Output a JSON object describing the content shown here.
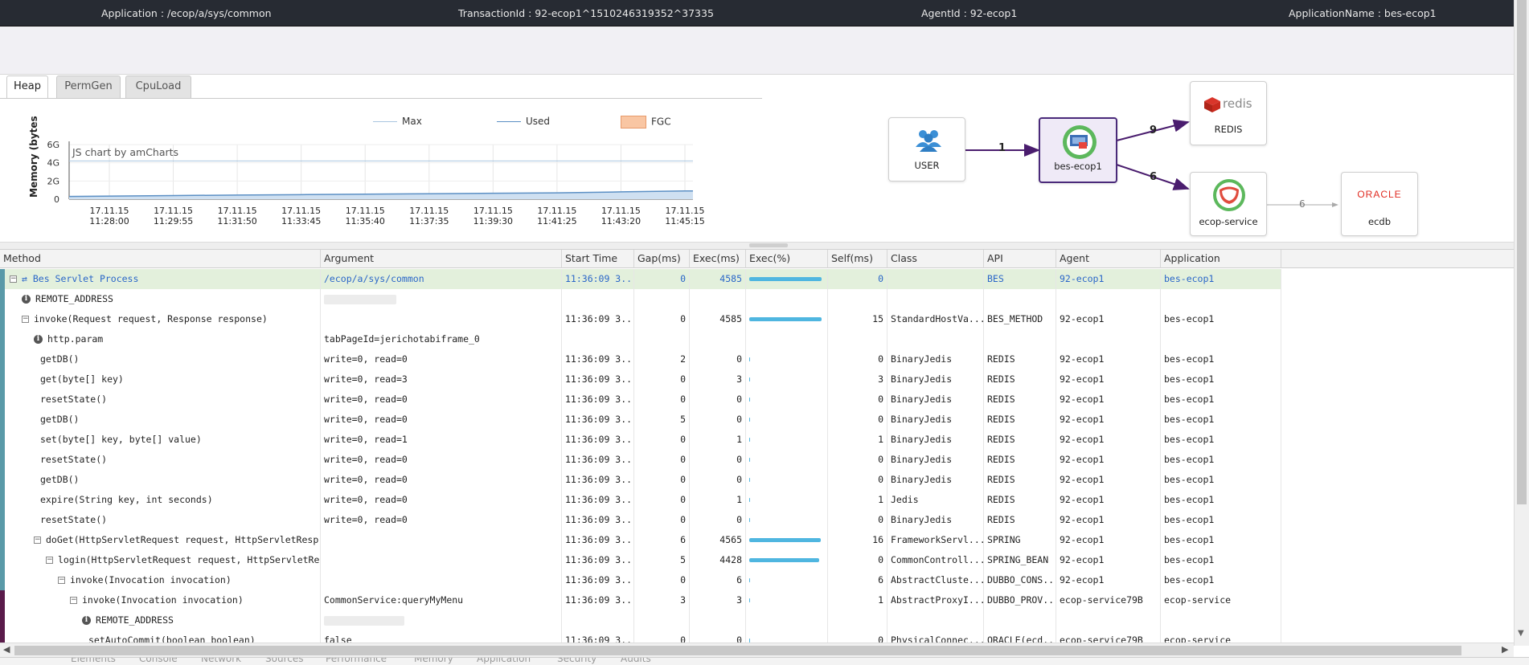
{
  "header": {
    "application": "Application : /ecop/a/sys/common",
    "transaction": "TransactionId : 92-ecop1^1510246319352^37335",
    "agent": "AgentId : 92-ecop1",
    "app_name": "ApplicationName : bes-ecop1"
  },
  "tabs": [
    {
      "label": "Heap",
      "active": true
    },
    {
      "label": "PermGen",
      "active": false
    },
    {
      "label": "CpuLoad",
      "active": false
    }
  ],
  "chart_data": {
    "type": "area",
    "ylabel": "Memory (bytes",
    "yticks": [
      "0",
      "2G",
      "4G",
      "6G"
    ],
    "ylim": [
      0,
      6
    ],
    "watermark": "JS chart by amCharts",
    "legend": [
      "Max",
      "Used",
      "FGC"
    ],
    "xticks": [
      [
        "17.11.15",
        "11:28:00"
      ],
      [
        "17.11.15",
        "11:29:55"
      ],
      [
        "17.11.15",
        "11:31:50"
      ],
      [
        "17.11.15",
        "11:33:45"
      ],
      [
        "17.11.15",
        "11:35:40"
      ],
      [
        "17.11.15",
        "11:37:35"
      ],
      [
        "17.11.15",
        "11:39:30"
      ],
      [
        "17.11.15",
        "11:41:25"
      ],
      [
        "17.11.15",
        "11:43:20"
      ],
      [
        "17.11.15",
        "11:45:15"
      ]
    ],
    "series": [
      {
        "name": "Max",
        "color": "#a9c6e0",
        "values": [
          4.2,
          4.2,
          4.2,
          4.2,
          4.2,
          4.2,
          4.2,
          4.2,
          4.2,
          4.2
        ]
      },
      {
        "name": "Used",
        "color": "#5b8fc4",
        "values": [
          0.3,
          0.4,
          0.45,
          0.5,
          0.55,
          0.6,
          0.65,
          0.7,
          0.8,
          0.9
        ]
      }
    ],
    "colors": {
      "fgc": "#f9c6a3",
      "used_fill": "#cfe0f1"
    }
  },
  "service_map": {
    "nodes": {
      "user": "USER",
      "bes": "bes-ecop1",
      "redis": "REDIS",
      "redis_logo": "redis",
      "ecop": "ecop-service",
      "ecdb": "ecdb",
      "oracle_logo": "ORACLE"
    },
    "edges": {
      "user_bes": "1",
      "bes_redis": "9",
      "bes_ecop": "6",
      "ecop_ecdb": "6"
    }
  },
  "grid": {
    "columns": [
      "Method",
      "Argument",
      "Start Time",
      "Gap(ms)",
      "Exec(ms)",
      "Exec(%)",
      "Self(ms)",
      "Class",
      "API",
      "Agent",
      "Application"
    ],
    "rows": [
      {
        "depth": 0,
        "icon": "toggle",
        "method": "Bes Servlet Process",
        "argument": "/ecop/a/sys/common",
        "start": "11:36:09 3...",
        "gap": "0",
        "exec": "4585",
        "pct": 1.0,
        "self": "0",
        "cls": "",
        "api": "BES",
        "agent": "92-ecop1",
        "app": "bes-ecop1",
        "style": "blue"
      },
      {
        "depth": 1,
        "icon": "info",
        "method": "REMOTE_ADDRESS",
        "argument": "",
        "blur": 90,
        "start": "",
        "gap": "",
        "exec": "",
        "pct": -1,
        "self": "",
        "cls": "",
        "api": "",
        "agent": "",
        "app": ""
      },
      {
        "depth": 1,
        "icon": "toggle",
        "method": "invoke(Request request, Response response)",
        "argument": "",
        "start": "11:36:09 3...",
        "gap": "0",
        "exec": "4585",
        "pct": 1.0,
        "self": "15",
        "cls": "StandardHostVa...",
        "api": "BES_METHOD",
        "agent": "92-ecop1",
        "app": "bes-ecop1"
      },
      {
        "depth": 2,
        "icon": "info",
        "method": "http.param",
        "argument": "tabPageId=jerichotabiframe_0",
        "start": "",
        "gap": "",
        "exec": "",
        "pct": -1,
        "self": "",
        "cls": "",
        "api": "",
        "agent": "",
        "app": ""
      },
      {
        "depth": 2,
        "icon": "",
        "method": "getDB()",
        "argument": "write=0, read=0",
        "start": "11:36:09 3...",
        "gap": "2",
        "exec": "0",
        "pct": 0.0,
        "self": "0",
        "cls": "BinaryJedis",
        "api": "REDIS",
        "agent": "92-ecop1",
        "app": "bes-ecop1"
      },
      {
        "depth": 2,
        "icon": "",
        "method": "get(byte[] key)",
        "argument": "write=0, read=3",
        "start": "11:36:09 3...",
        "gap": "0",
        "exec": "3",
        "pct": 0.0,
        "self": "3",
        "cls": "BinaryJedis",
        "api": "REDIS",
        "agent": "92-ecop1",
        "app": "bes-ecop1"
      },
      {
        "depth": 2,
        "icon": "",
        "method": "resetState()",
        "argument": "write=0, read=0",
        "start": "11:36:09 3...",
        "gap": "0",
        "exec": "0",
        "pct": 0.0,
        "self": "0",
        "cls": "BinaryJedis",
        "api": "REDIS",
        "agent": "92-ecop1",
        "app": "bes-ecop1"
      },
      {
        "depth": 2,
        "icon": "",
        "method": "getDB()",
        "argument": "write=0, read=0",
        "start": "11:36:09 3...",
        "gap": "5",
        "exec": "0",
        "pct": 0.0,
        "self": "0",
        "cls": "BinaryJedis",
        "api": "REDIS",
        "agent": "92-ecop1",
        "app": "bes-ecop1"
      },
      {
        "depth": 2,
        "icon": "",
        "method": "set(byte[] key, byte[] value)",
        "argument": "write=0, read=1",
        "start": "11:36:09 3...",
        "gap": "0",
        "exec": "1",
        "pct": 0.0,
        "self": "1",
        "cls": "BinaryJedis",
        "api": "REDIS",
        "agent": "92-ecop1",
        "app": "bes-ecop1"
      },
      {
        "depth": 2,
        "icon": "",
        "method": "resetState()",
        "argument": "write=0, read=0",
        "start": "11:36:09 3...",
        "gap": "0",
        "exec": "0",
        "pct": 0.0,
        "self": "0",
        "cls": "BinaryJedis",
        "api": "REDIS",
        "agent": "92-ecop1",
        "app": "bes-ecop1"
      },
      {
        "depth": 2,
        "icon": "",
        "method": "getDB()",
        "argument": "write=0, read=0",
        "start": "11:36:09 3...",
        "gap": "0",
        "exec": "0",
        "pct": 0.0,
        "self": "0",
        "cls": "BinaryJedis",
        "api": "REDIS",
        "agent": "92-ecop1",
        "app": "bes-ecop1"
      },
      {
        "depth": 2,
        "icon": "",
        "method": "expire(String key, int seconds)",
        "argument": "write=0, read=0",
        "start": "11:36:09 3...",
        "gap": "0",
        "exec": "1",
        "pct": 0.0,
        "self": "1",
        "cls": "Jedis",
        "api": "REDIS",
        "agent": "92-ecop1",
        "app": "bes-ecop1"
      },
      {
        "depth": 2,
        "icon": "",
        "method": "resetState()",
        "argument": "write=0, read=0",
        "start": "11:36:09 3...",
        "gap": "0",
        "exec": "0",
        "pct": 0.0,
        "self": "0",
        "cls": "BinaryJedis",
        "api": "REDIS",
        "agent": "92-ecop1",
        "app": "bes-ecop1"
      },
      {
        "depth": 2,
        "icon": "toggle",
        "method": "doGet(HttpServletRequest request, HttpServletResp",
        "argument": "",
        "start": "11:36:09 3...",
        "gap": "6",
        "exec": "4565",
        "pct": 0.99,
        "self": "16",
        "cls": "FrameworkServl...",
        "api": "SPRING",
        "agent": "92-ecop1",
        "app": "bes-ecop1"
      },
      {
        "depth": 3,
        "icon": "toggle",
        "method": "login(HttpServletRequest request, HttpServletRe",
        "argument": "",
        "start": "11:36:09 3...",
        "gap": "5",
        "exec": "4428",
        "pct": 0.97,
        "self": "0",
        "cls": "CommonControll...",
        "api": "SPRING_BEAN",
        "agent": "92-ecop1",
        "app": "bes-ecop1"
      },
      {
        "depth": 4,
        "icon": "toggle",
        "method": "invoke(Invocation invocation)",
        "argument": "",
        "start": "11:36:09 3...",
        "gap": "0",
        "exec": "6",
        "pct": 0.0,
        "self": "6",
        "cls": "AbstractCluste...",
        "api": "DUBBO_CONS...",
        "agent": "92-ecop1",
        "app": "bes-ecop1"
      },
      {
        "depth": 5,
        "icon": "toggle",
        "method": "invoke(Invocation invocation)",
        "argument": "CommonService:queryMyMenu",
        "start": "11:36:09 3...",
        "gap": "3",
        "exec": "3",
        "pct": 0.0,
        "self": "1",
        "cls": "AbstractProxyI...",
        "api": "DUBBO_PROV...",
        "agent": "ecop-service79B",
        "app": "ecop-service",
        "marker": "#5a1b4a"
      },
      {
        "depth": 6,
        "icon": "info",
        "method": "REMOTE_ADDRESS",
        "argument": "",
        "blur": 100,
        "start": "",
        "gap": "",
        "exec": "",
        "pct": -1,
        "self": "",
        "cls": "",
        "api": "",
        "agent": "",
        "app": "",
        "marker": "#5a1b4a"
      },
      {
        "depth": 6,
        "icon": "",
        "method": "setAutoCommit(boolean boolean)",
        "argument": "false",
        "start": "11:36:09 3...",
        "gap": "0",
        "exec": "0",
        "pct": 0.0,
        "self": "0",
        "cls": "PhysicalConnec...",
        "api": "ORACLE(ecd...",
        "agent": "ecop-service79B",
        "app": "ecop-service",
        "marker": "#5a1b4a"
      }
    ]
  },
  "devtools": [
    "Elements",
    "Console",
    "Network",
    "Sources",
    "Performance",
    "Memory",
    "Application",
    "Security",
    "Audits"
  ]
}
